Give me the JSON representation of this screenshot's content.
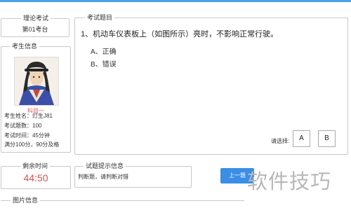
{
  "exam_type": {
    "legend": "理论考试",
    "seat": "第01考台"
  },
  "candidate": {
    "legend": "考生信息",
    "subject": "科目一",
    "info": [
      "考生姓名：灯生J81",
      "考试题数：100",
      "考试时间：45分钟",
      "满分100分，90分及格"
    ]
  },
  "question": {
    "legend": "考试题目",
    "text": "1、机动车仪表板上（如图所示）亮时，不影响正常行驶。",
    "options": [
      "A、正确",
      "B、错误"
    ],
    "answer_label": "请选择:",
    "answer_buttons": [
      "A",
      "B"
    ]
  },
  "timer": {
    "legend": "剩余时间",
    "value": "44:50"
  },
  "hint": {
    "legend": "试题提示信息",
    "text": "判断题，请判断对错"
  },
  "nav": {
    "prev_label": "上一题"
  },
  "image_info": {
    "legend": "图片信息"
  },
  "watermark": "软件技巧",
  "colors": {
    "accent": "#3a8ee6",
    "timer": "#d9534f",
    "subject": "#e05a5a",
    "topbar": "#4aa3e8"
  }
}
